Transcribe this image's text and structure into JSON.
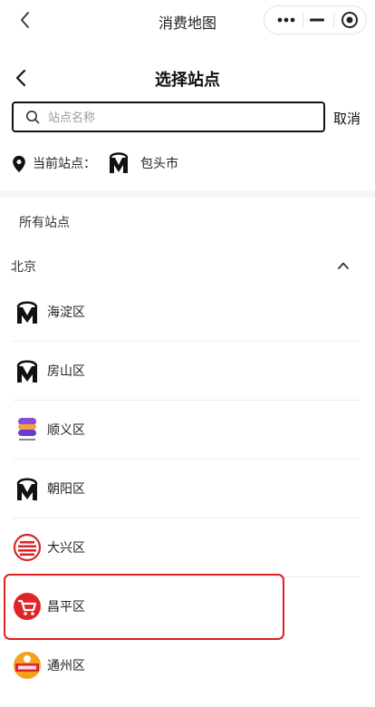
{
  "topbar": {
    "title": "消费地图",
    "back_icon": "chevron-left-icon",
    "capsule_icons": [
      "more-dots-icon",
      "minimize-icon",
      "close-target-icon"
    ]
  },
  "header": {
    "title": "选择站点"
  },
  "search": {
    "placeholder": "站点名称",
    "value": "",
    "cancel_label": "取消"
  },
  "current": {
    "label": "当前站点：",
    "value": "包头市",
    "logo": "m-logo"
  },
  "all_title": "所有站点",
  "city": {
    "name": "北京",
    "expanded": true
  },
  "districts": [
    {
      "name": "海淀区",
      "logo": "m-logo"
    },
    {
      "name": "房山区",
      "logo": "m-logo"
    },
    {
      "name": "顺义区",
      "logo": "s-logo"
    },
    {
      "name": "朝阳区",
      "logo": "m-logo"
    },
    {
      "name": "大兴区",
      "logo": "red-stripes-logo"
    },
    {
      "name": "昌平区",
      "logo": "red-cart-logo",
      "selected": true
    },
    {
      "name": "通州区",
      "logo": "orange-badge-logo"
    }
  ],
  "colors": {
    "selection": "#e02020",
    "band": "#f5f6f8"
  }
}
